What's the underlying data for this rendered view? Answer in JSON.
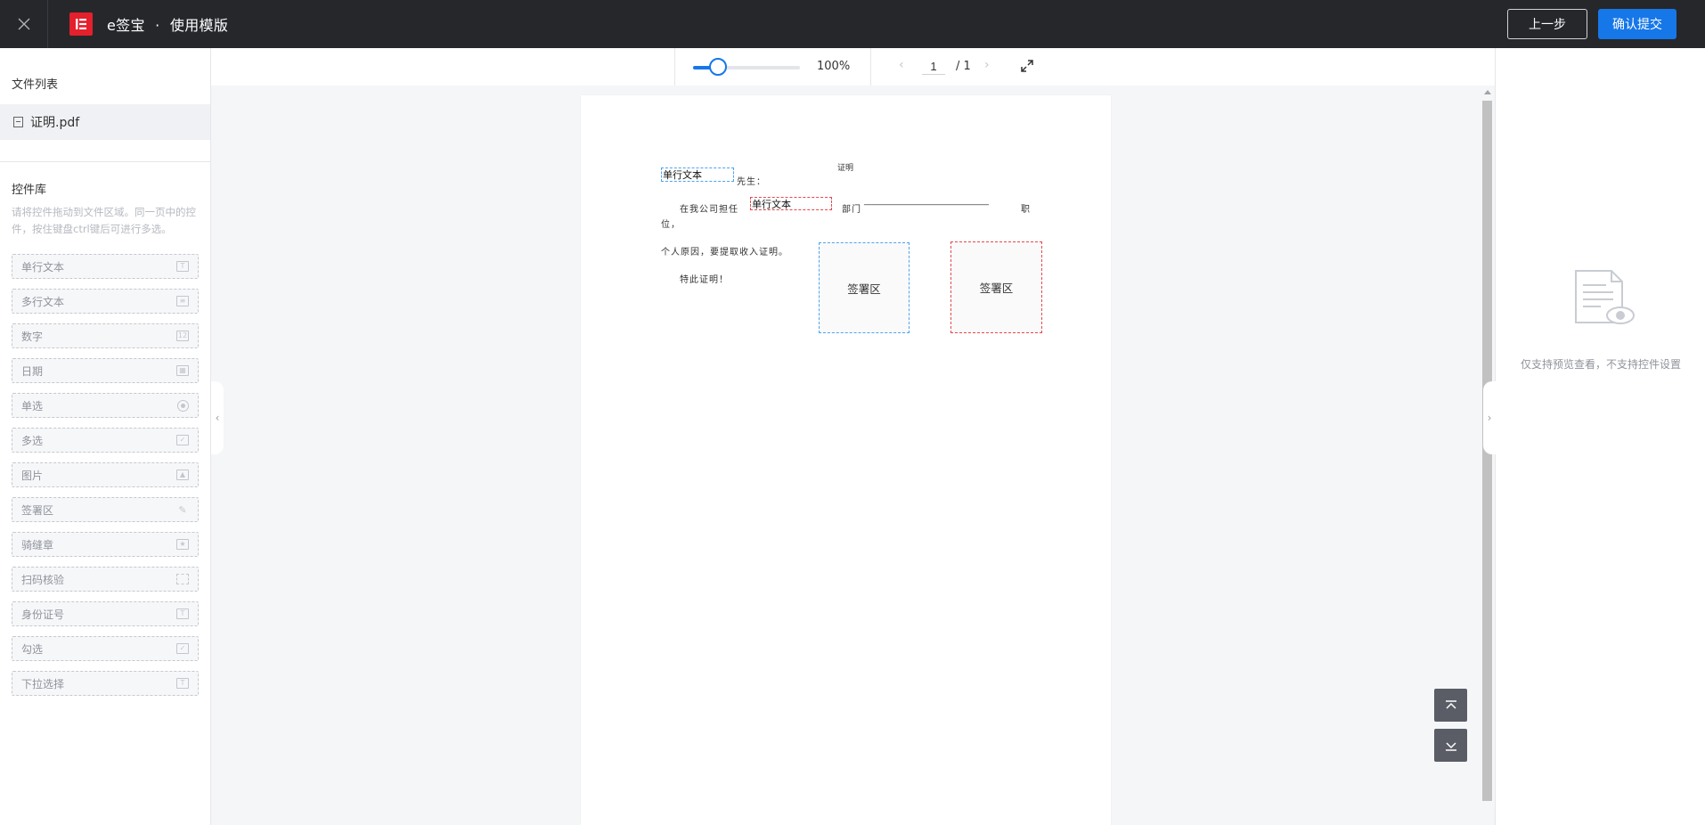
{
  "header": {
    "brand": "e签宝",
    "separator": "·",
    "title": "使用模版",
    "prev_label": "上一步",
    "submit_label": "确认提交"
  },
  "sidebar": {
    "files_title": "文件列表",
    "file_name": "证明.pdf",
    "controls_title": "控件库",
    "controls_hint": "请将控件拖动到文件区域。同一页中的控件，按住键盘ctrl键后可进行多选。",
    "controls": [
      {
        "label": "单行文本",
        "icon": "text-icon"
      },
      {
        "label": "多行文本",
        "icon": "multiline-icon"
      },
      {
        "label": "数字",
        "icon": "number-icon"
      },
      {
        "label": "日期",
        "icon": "calendar-icon"
      },
      {
        "label": "单选",
        "icon": "radio-icon"
      },
      {
        "label": "多选",
        "icon": "checkbox-icon"
      },
      {
        "label": "图片",
        "icon": "image-icon"
      },
      {
        "label": "签署区",
        "icon": "pen-icon"
      },
      {
        "label": "骑缝章",
        "icon": "stamp-icon"
      },
      {
        "label": "扫码核验",
        "icon": "scan-icon"
      },
      {
        "label": "身份证号",
        "icon": "id-icon"
      },
      {
        "label": "勾选",
        "icon": "check-icon"
      },
      {
        "label": "下拉选择",
        "icon": "dropdown-icon"
      }
    ]
  },
  "toolbar": {
    "zoom_label": "100%",
    "zoom_percent": 20,
    "page_current": "1",
    "page_total": "/ 1"
  },
  "document": {
    "title": "证明",
    "line1_suffix": "先生：",
    "line2_prefix": "在我公司担任",
    "line2_dept": "部门",
    "line2_blank": "____________________________",
    "line2_end": "职",
    "line3": "位，",
    "line4": "个人原因，要提取收入证明。",
    "line5": "特此证明！",
    "field_single_1": "单行文本",
    "field_single_2": "单行文本",
    "sig_1": "签署区",
    "sig_2": "签署区"
  },
  "right_panel": {
    "empty_text": "仅支持预览查看，不支持控件设置"
  }
}
